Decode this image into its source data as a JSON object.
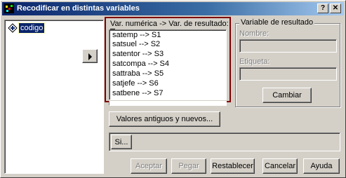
{
  "window": {
    "title": "Recodificar en distintas variables"
  },
  "source_list": {
    "items": [
      {
        "label": "codigo",
        "icon": "scale-variable-icon"
      }
    ]
  },
  "move_button": {
    "icon": "arrow-right-icon"
  },
  "mapping": {
    "label": "Var. numérica -> Var. de resultado:",
    "items": [
      "satemp --> S1",
      "satsuel --> S2",
      "satentor --> S3",
      "satcompa --> S4",
      "sattraba --> S5",
      "satjefe --> S6",
      "satbene --> S7"
    ],
    "highlight_color": "#800000"
  },
  "output_variable": {
    "group_label": "Variable de resultado",
    "name_label": "Nombre:",
    "name_value": "",
    "label_label": "Etiqueta:",
    "label_value": "",
    "change_button": "Cambiar"
  },
  "buttons": {
    "old_new_values": "Valores antiguos y nuevos...",
    "if": "Si...",
    "accept": "Aceptar",
    "paste": "Pegar",
    "reset": "Restablecer",
    "cancel": "Cancelar",
    "help": "Ayuda"
  },
  "colors": {
    "titlebar_start": "#0a246a",
    "titlebar_end": "#a6caf0",
    "face": "#d4d0c8",
    "selection": "#0a246a"
  }
}
